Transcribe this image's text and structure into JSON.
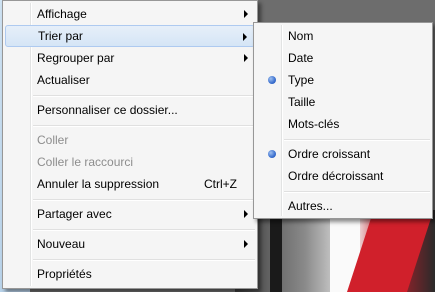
{
  "main_menu": {
    "items": [
      {
        "label": "Affichage"
      },
      {
        "label": "Trier par"
      },
      {
        "label": "Regrouper par"
      },
      {
        "label": "Actualiser"
      },
      {
        "label": "Personnaliser ce dossier..."
      },
      {
        "label": "Coller"
      },
      {
        "label": "Coller le raccourci"
      },
      {
        "label": "Annuler la suppression",
        "shortcut": "Ctrl+Z"
      },
      {
        "label": "Partager avec"
      },
      {
        "label": "Nouveau"
      },
      {
        "label": "Propriétés"
      }
    ]
  },
  "sort_submenu": {
    "items": [
      {
        "label": "Nom"
      },
      {
        "label": "Date"
      },
      {
        "label": "Type",
        "checked": true
      },
      {
        "label": "Taille"
      },
      {
        "label": "Mots-clés"
      },
      {
        "label": "Ordre croissant",
        "checked": true
      },
      {
        "label": "Ordre décroissant"
      },
      {
        "label": "Autres..."
      }
    ]
  },
  "icons": {
    "submenu_arrow": "chevron-right-icon",
    "radio_bullet": "radio-bullet-icon"
  },
  "colors": {
    "menu_bg": "#f5f5f5",
    "selection_bg": "#dce9f7",
    "selection_border": "#aecaf0",
    "disabled_text": "#8d8d8d"
  }
}
